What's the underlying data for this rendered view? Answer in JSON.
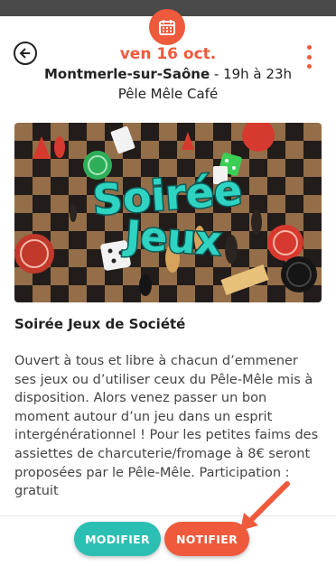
{
  "header": {
    "date": "ven 16 oct.",
    "city": "Montmerle-sur-Saône",
    "time_range": " - 19h à 23h",
    "venue": "Pêle Mêle Café",
    "back_icon": "back-arrow-icon",
    "calendar_icon": "calendar-icon",
    "menu_icon": "more-vertical-icon"
  },
  "hero": {
    "title_line1": "Soirée",
    "title_line2": "Jeux"
  },
  "event": {
    "title": "Soirée Jeux de Société",
    "description": "Ouvert à tous et libre à chacun d’emmener ses jeux ou d’utiliser ceux du Pêle-Mêle mis à disposition. Alors venez passer un bon moment autour d’un jeu dans un esprit intergénérationnel ! Pour les petites faims des assiettes de charcuterie/fromage à 8€ seront proposées par le Pêle-Mêle. Participation : gratuit"
  },
  "actions": {
    "modify_label": "MODIFIER",
    "notify_label": "NOTIFIER"
  },
  "colors": {
    "accent": "#ee5a3b",
    "teal": "#2bbfb3"
  }
}
